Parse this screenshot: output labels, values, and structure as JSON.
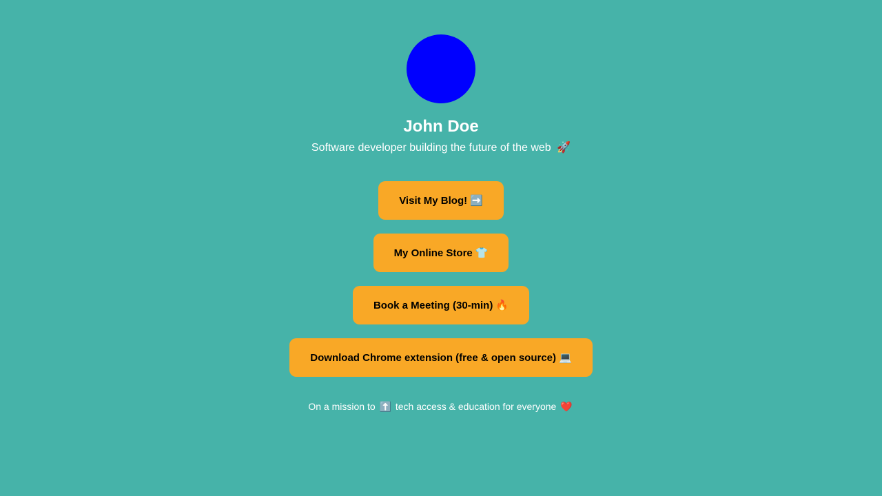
{
  "profile": {
    "avatar_color": "#0000ff",
    "name": "John Doe",
    "bio": "Software developer building the future of the web",
    "bio_emoji": "🚀"
  },
  "links": [
    {
      "label": "Visit My Blog!",
      "emoji": "➡️"
    },
    {
      "label": "My Online Store",
      "emoji": "👕"
    },
    {
      "label": "Book a Meeting (30-min)",
      "emoji": "🔥"
    },
    {
      "label": "Download Chrome extension (free & open source)",
      "emoji": "💻"
    }
  ],
  "footer": {
    "prefix": "On a mission to",
    "up_emoji": "⬆️",
    "middle": "tech access & education for everyone",
    "heart_emoji": "❤️"
  },
  "colors": {
    "background": "#46b3a9",
    "button": "#f9a826",
    "text": "#ffffff"
  }
}
